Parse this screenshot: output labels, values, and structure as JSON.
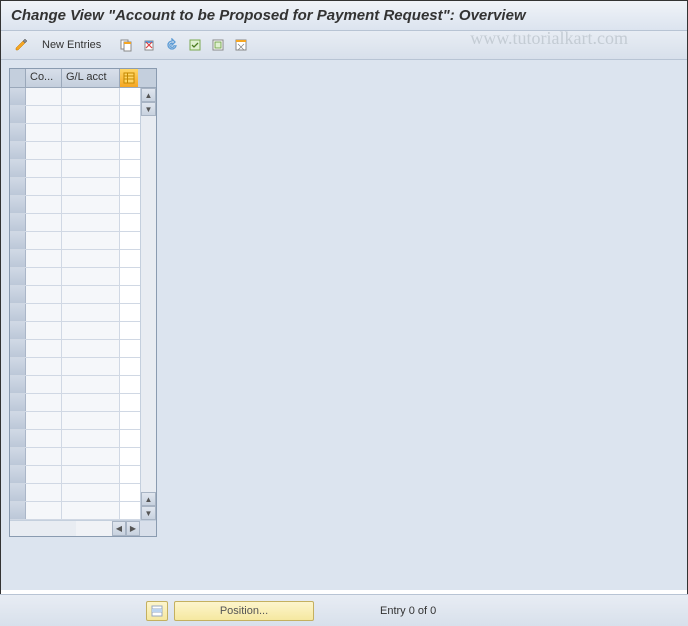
{
  "title": "Change View \"Account to be Proposed for Payment Request\": Overview",
  "watermark": "www.tutorialkart.com",
  "toolbar": {
    "new_entries": "New Entries"
  },
  "columns": {
    "co": "Co...",
    "gl": "G/L acct"
  },
  "rows": [
    {
      "co": "",
      "gl": ""
    },
    {
      "co": "",
      "gl": ""
    },
    {
      "co": "",
      "gl": ""
    },
    {
      "co": "",
      "gl": ""
    },
    {
      "co": "",
      "gl": ""
    },
    {
      "co": "",
      "gl": ""
    },
    {
      "co": "",
      "gl": ""
    },
    {
      "co": "",
      "gl": ""
    },
    {
      "co": "",
      "gl": ""
    },
    {
      "co": "",
      "gl": ""
    },
    {
      "co": "",
      "gl": ""
    },
    {
      "co": "",
      "gl": ""
    },
    {
      "co": "",
      "gl": ""
    },
    {
      "co": "",
      "gl": ""
    },
    {
      "co": "",
      "gl": ""
    },
    {
      "co": "",
      "gl": ""
    },
    {
      "co": "",
      "gl": ""
    },
    {
      "co": "",
      "gl": ""
    },
    {
      "co": "",
      "gl": ""
    },
    {
      "co": "",
      "gl": ""
    },
    {
      "co": "",
      "gl": ""
    },
    {
      "co": "",
      "gl": ""
    },
    {
      "co": "",
      "gl": ""
    },
    {
      "co": "",
      "gl": ""
    }
  ],
  "footer": {
    "position_label": "Position...",
    "entry_text": "Entry 0 of 0"
  }
}
